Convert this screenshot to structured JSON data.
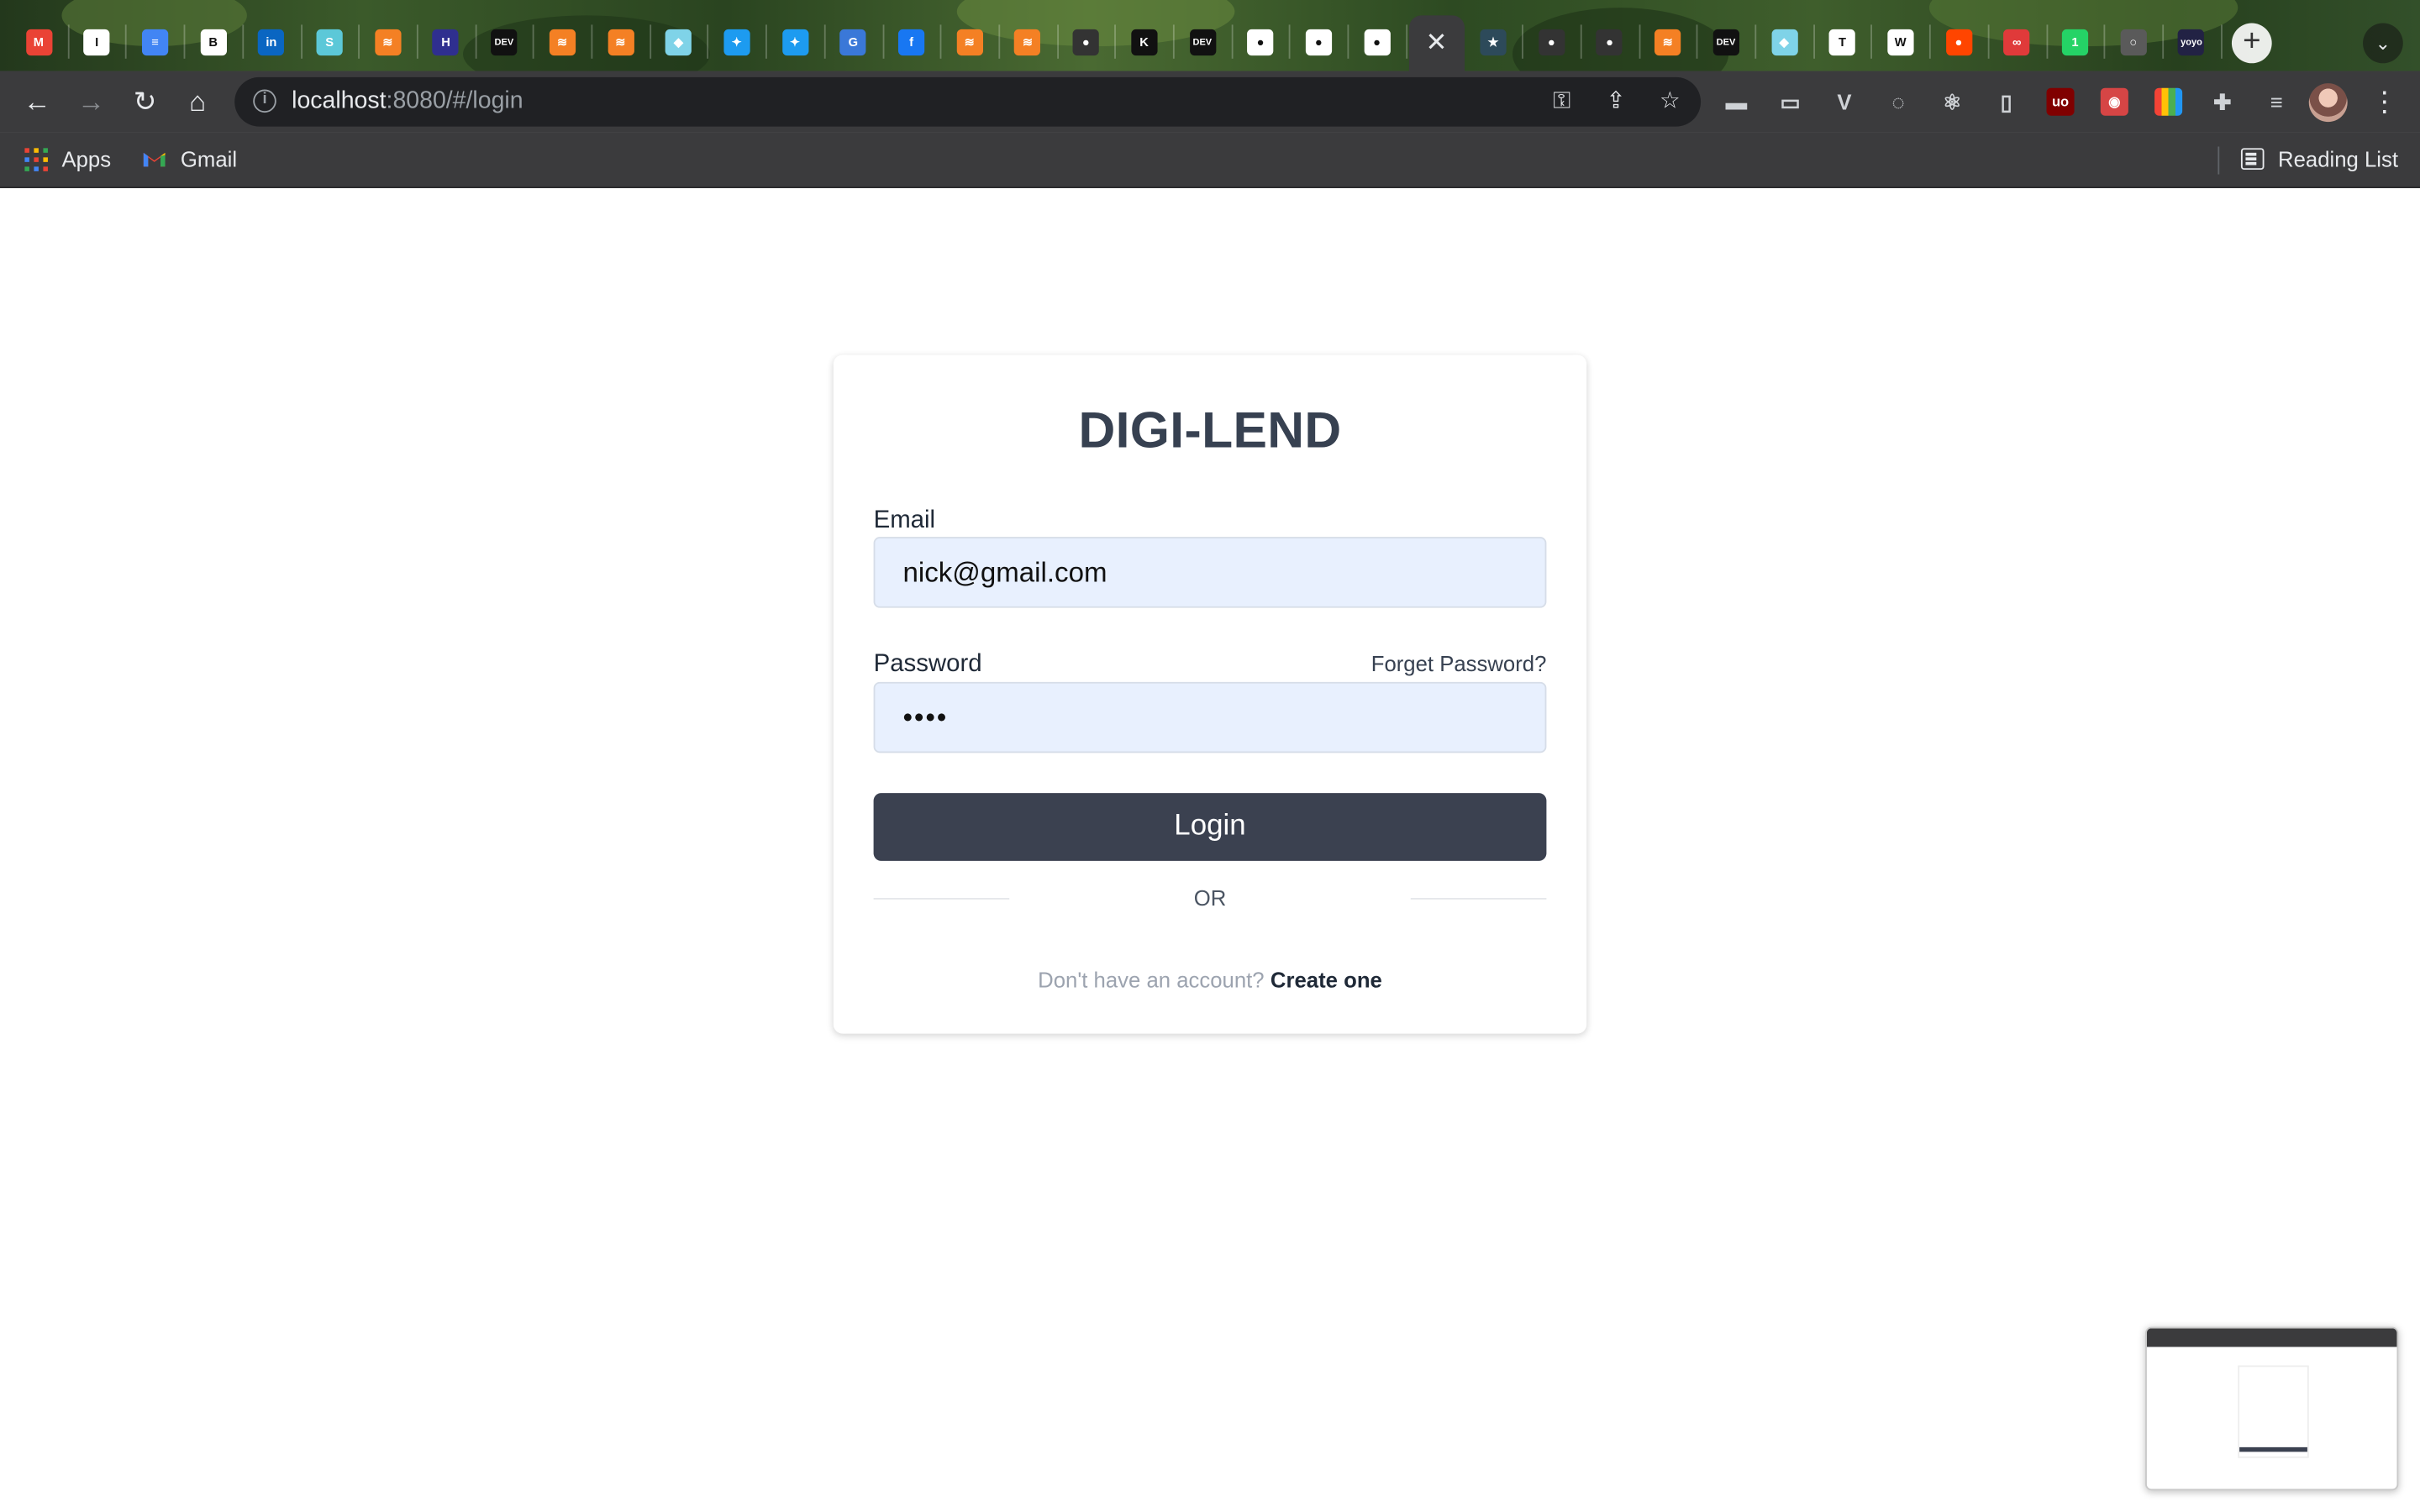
{
  "browser": {
    "tabs": [
      {
        "icon": "gmail-icon",
        "glyph": "M",
        "color": "#ea4335"
      },
      {
        "icon": "instapaper-icon",
        "glyph": "I",
        "color": "#ffffff"
      },
      {
        "icon": "docs-icon",
        "glyph": "≡",
        "color": "#4285f4"
      },
      {
        "icon": "bookmark-app-icon",
        "glyph": "B",
        "color": "#ffffff"
      },
      {
        "icon": "linkedin-icon",
        "glyph": "in",
        "color": "#0a66c2"
      },
      {
        "icon": "s-app-icon",
        "glyph": "S",
        "color": "#5cc8d8"
      },
      {
        "icon": "stackoverflow-icon",
        "glyph": "≋",
        "color": "#f48024"
      },
      {
        "icon": "hashnode-icon",
        "glyph": "H",
        "color": "#2f2f8f"
      },
      {
        "icon": "dev-icon",
        "glyph": "DEV",
        "color": "#111111"
      },
      {
        "icon": "stackoverflow-icon",
        "glyph": "≋",
        "color": "#f48024"
      },
      {
        "icon": "stackoverflow-icon",
        "glyph": "≋",
        "color": "#f48024"
      },
      {
        "icon": "cube-icon",
        "glyph": "◆",
        "color": "#7fd3e8"
      },
      {
        "icon": "twitter-icon",
        "glyph": "✦",
        "color": "#1d9bf0"
      },
      {
        "icon": "twitter-icon",
        "glyph": "✦",
        "color": "#1d9bf0"
      },
      {
        "icon": "grammarly-icon",
        "glyph": "G",
        "color": "#3a78d8"
      },
      {
        "icon": "facebook-icon",
        "glyph": "f",
        "color": "#1877f2"
      },
      {
        "icon": "stackoverflow-icon",
        "glyph": "≋",
        "color": "#f48024"
      },
      {
        "icon": "stackoverflow-icon",
        "glyph": "≋",
        "color": "#f48024"
      },
      {
        "icon": "github-icon",
        "glyph": "●",
        "color": "#333333"
      },
      {
        "icon": "k-app-icon",
        "glyph": "K",
        "color": "#111111"
      },
      {
        "icon": "dev-icon",
        "glyph": "DEV",
        "color": "#111111"
      },
      {
        "icon": "globe-icon",
        "glyph": "●",
        "color": "#ffffff"
      },
      {
        "icon": "globe-icon",
        "glyph": "●",
        "color": "#ffffff"
      },
      {
        "icon": "globe-icon",
        "glyph": "●",
        "color": "#ffffff"
      },
      {
        "icon": "close-icon",
        "glyph": "✕",
        "color": "#e8eaed",
        "active": true
      },
      {
        "icon": "star-app-icon",
        "glyph": "★",
        "color": "#2d4a5a"
      },
      {
        "icon": "github-icon",
        "glyph": "●",
        "color": "#333333"
      },
      {
        "icon": "github-icon",
        "glyph": "●",
        "color": "#333333"
      },
      {
        "icon": "stackoverflow-icon",
        "glyph": "≋",
        "color": "#f48024"
      },
      {
        "icon": "dev-icon",
        "glyph": "DEV",
        "color": "#111111"
      },
      {
        "icon": "cube-icon",
        "glyph": "◆",
        "color": "#7fd3e8"
      },
      {
        "icon": "instapaper-icon",
        "glyph": "T",
        "color": "#ffffff"
      },
      {
        "icon": "wiki-icon",
        "glyph": "W",
        "color": "#ffffff"
      },
      {
        "icon": "reddit-icon",
        "glyph": "●",
        "color": "#ff4500"
      },
      {
        "icon": "red-link-icon",
        "glyph": "∞",
        "color": "#e03a3a"
      },
      {
        "icon": "whatsapp-icon",
        "glyph": "1",
        "color": "#25d366"
      },
      {
        "icon": "gray-circle-icon",
        "glyph": "○",
        "color": "#5a5a5a"
      },
      {
        "icon": "yoyo-icon",
        "glyph": "yoyo",
        "color": "#222244"
      }
    ],
    "address": {
      "host": "localhost",
      "rest": ":8080/#/login"
    },
    "extensions": [
      {
        "icon": "truck-ext-icon",
        "glyph": "▬",
        "color": "transparent"
      },
      {
        "icon": "bus-ext-icon",
        "glyph": "▭",
        "color": "transparent"
      },
      {
        "icon": "vue-devtools-icon",
        "glyph": "V",
        "color": "transparent"
      },
      {
        "icon": "grammarly-ext-icon",
        "glyph": "◌",
        "color": "transparent"
      },
      {
        "icon": "react-devtools-icon",
        "glyph": "⚛",
        "color": "transparent"
      },
      {
        "icon": "bookmark-ext-icon",
        "glyph": "▯",
        "color": "transparent"
      },
      {
        "icon": "ublock-icon",
        "glyph": "uo",
        "color": "#800000"
      },
      {
        "icon": "red-ext-icon",
        "glyph": "◉",
        "color": "#d64545"
      },
      {
        "icon": "palette-ext-icon",
        "glyph": "",
        "color": "palette"
      },
      {
        "icon": "puzzle-icon",
        "glyph": "✚",
        "color": "transparent"
      },
      {
        "icon": "media-queue-icon",
        "glyph": "≡",
        "color": "transparent"
      }
    ],
    "bookmarks": {
      "apps": "Apps",
      "gmail": "Gmail",
      "reading_list": "Reading List"
    }
  },
  "login": {
    "title": "DIGI-LEND",
    "email_label": "Email",
    "email_value": "nick@gmail.com",
    "password_label": "Password",
    "password_value": "••••",
    "forgot": "Forget Password?",
    "button": "Login",
    "or": "OR",
    "no_account": "Don't have an account?",
    "create": "Create one"
  },
  "colors": {
    "button_bg": "#3b4150",
    "input_bg": "#e8f0fe",
    "title": "#374151"
  }
}
